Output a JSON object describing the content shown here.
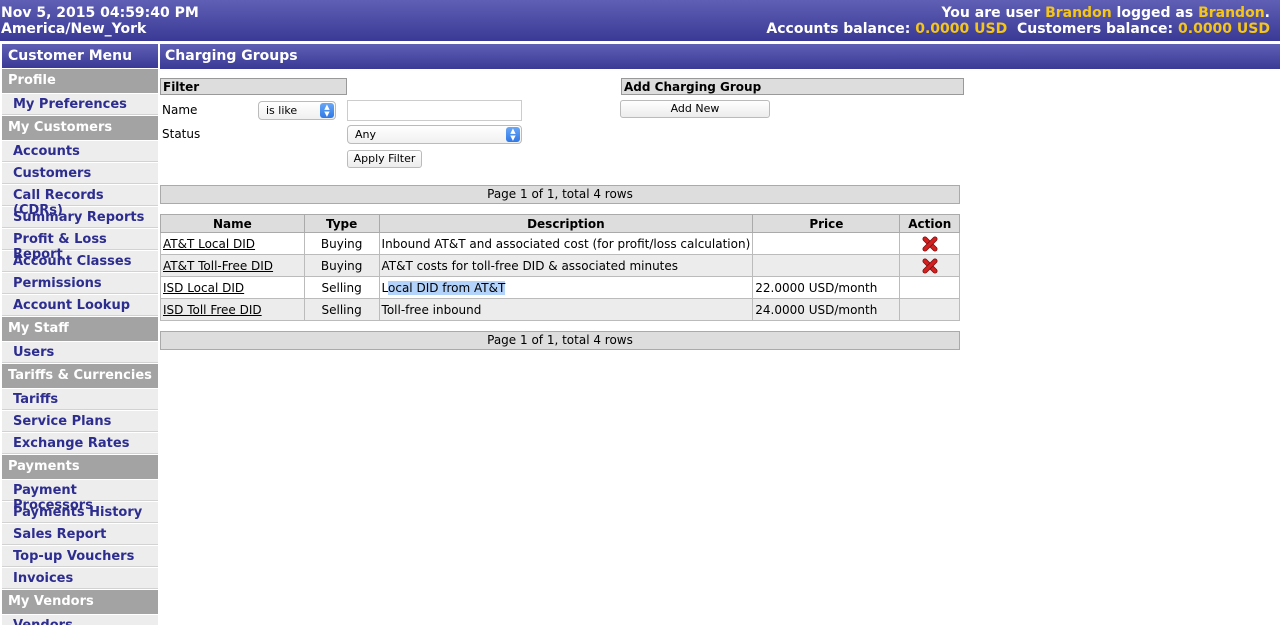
{
  "header": {
    "datetime": "Nov 5, 2015 04:59:40 PM",
    "timezone": "America/New_York",
    "user_prefix": "You are user ",
    "user_name": "Brandon",
    "logged_as": " logged as ",
    "logged_name": "Brandon",
    "logged_suffix": ".",
    "accounts_balance_label": "Accounts balance: ",
    "accounts_balance": "0.0000 USD",
    "customers_balance_label": "  Customers balance: ",
    "customers_balance": "0.0000 USD"
  },
  "sidebar": {
    "title": "Customer Menu",
    "sections": [
      {
        "label": "Profile",
        "items": [
          "My Preferences"
        ]
      },
      {
        "label": "My Customers",
        "items": [
          "Accounts",
          "Customers",
          "Call Records (CDRs)",
          "Summary Reports",
          "Profit & Loss Report",
          "Account Classes",
          "Permissions",
          "Account Lookup"
        ]
      },
      {
        "label": "My Staff",
        "items": [
          "Users"
        ]
      },
      {
        "label": "Tariffs & Currencies",
        "items": [
          "Tariffs",
          "Service Plans",
          "Exchange Rates"
        ]
      },
      {
        "label": "Payments",
        "items": [
          "Payment Processors",
          "Payments History",
          "Sales Report",
          "Top-up Vouchers",
          "Invoices"
        ]
      },
      {
        "label": "My Vendors",
        "items": [
          "Vendors"
        ]
      }
    ]
  },
  "main": {
    "title": "Charging Groups",
    "filter": {
      "heading": "Filter",
      "name_label": "Name",
      "name_operator": "is like",
      "name_value": "",
      "status_label": "Status",
      "status_value": "Any",
      "apply_label": "Apply Filter"
    },
    "add": {
      "heading": "Add Charging Group",
      "button_label": "Add New"
    },
    "pager_text": "Page 1 of 1, total 4 rows",
    "columns": [
      "Name",
      "Type",
      "Description",
      "Price",
      "Action"
    ],
    "rows": [
      {
        "name": "AT&T Local DID",
        "type": "Buying",
        "description": "Inbound AT&T and associated cost (for profit/loss calculation)",
        "price": "",
        "deletable": true
      },
      {
        "name": "AT&T Toll-Free DID",
        "type": "Buying",
        "description": "AT&T costs for toll-free DID & associated minutes",
        "price": "",
        "deletable": true
      },
      {
        "name": "ISD Local DID",
        "type": "Selling",
        "description": "Local DID from AT&T",
        "price": "22.0000 USD/month",
        "deletable": false
      },
      {
        "name": "ISD Toll Free DID",
        "type": "Selling",
        "description": "Toll-free inbound",
        "price": "24.0000 USD/month",
        "deletable": false
      }
    ]
  },
  "colors": {
    "header_blue": "#3a3a96",
    "highlight_yellow": "#f5c518",
    "menu_link": "#2d2d8f",
    "delete_red": "#d42020"
  },
  "icons": {
    "delete": "delete-icon",
    "dropdown": "dropdown-arrow-icon"
  }
}
